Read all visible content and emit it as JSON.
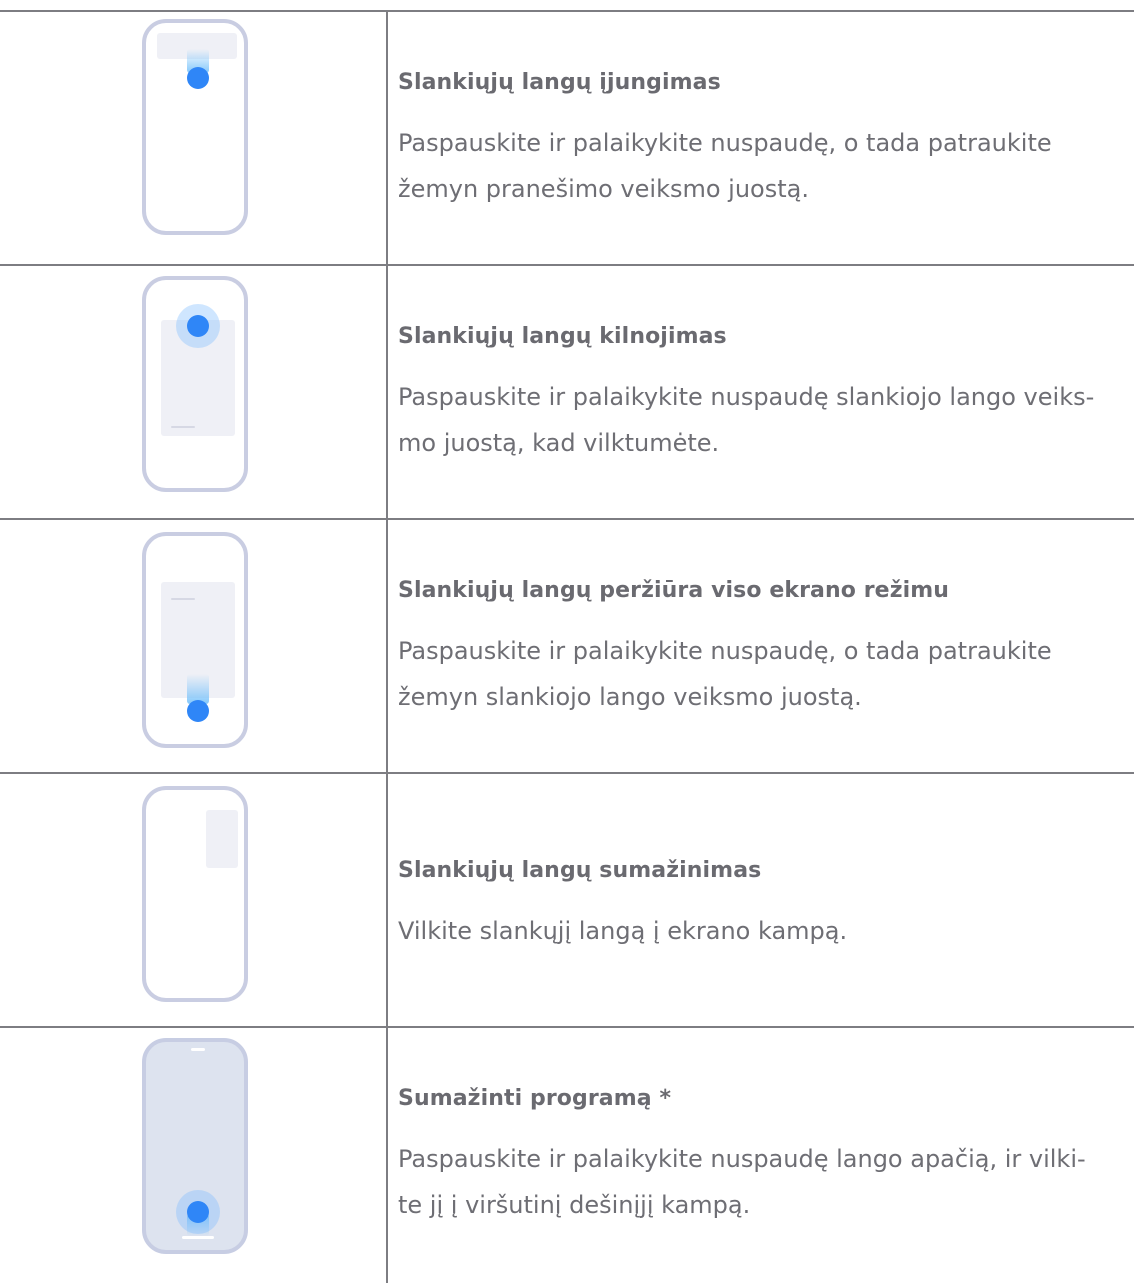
{
  "rows": [
    {
      "title": "Slankiųjų langų įjungimas",
      "lines": [
        "Paspauskite ir palaikykite nuspaudę, o tada patraukite",
        "žemyn pranešimo veiksmo juostą."
      ],
      "icon": "phone-pull-down-notification-icon"
    },
    {
      "title": "Slankiųjų langų kilnojimas",
      "lines": [
        "Paspauskite ir palaikykite nuspaudę slankiojo lango veiks-",
        "mo juostą, kad vilktumėte."
      ],
      "icon": "phone-drag-floating-window-icon"
    },
    {
      "title": "Slankiųjų langų peržiūra viso ekrano režimu",
      "lines": [
        "Paspauskite ir palaikykite nuspaudę, o tada patraukite",
        "žemyn slankiojo lango veiksmo juostą."
      ],
      "icon": "phone-fullscreen-floating-window-icon"
    },
    {
      "title": "Slankiųjų langų sumažinimas",
      "lines": [
        "Vilkite slankųjį langą į ekrano kampą."
      ],
      "icon": "phone-minimize-floating-window-icon"
    },
    {
      "title": "Sumažinti programą *",
      "lines": [
        "Paspauskite ir palaikykite nuspaudę lango apačią, ir vilki-",
        "te jį į viršutinį dešinįjį kampą."
      ],
      "icon": "phone-minimize-app-icon"
    }
  ],
  "colors": {
    "accent_dot": "#2f86f7",
    "phone_outline": "#c9cde2",
    "window_fill": "#eff0f6",
    "rule": "#7d7d82",
    "text": "#6e6e74"
  }
}
